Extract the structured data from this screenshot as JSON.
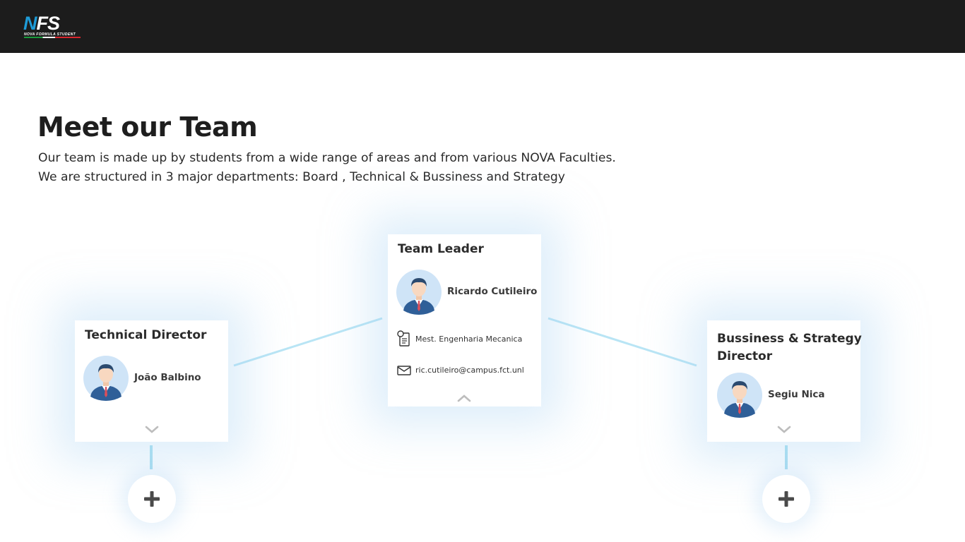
{
  "header": {
    "logo_text": "NFS",
    "logo_subtext": "NOVA FORMULA STUDENT",
    "background_color": "#1c1c1c"
  },
  "hero": {
    "title": "Meet our Team",
    "intro_line1": "Our team is made up by students from a wide range of areas and from various NOVA Faculties.",
    "intro_line2": "We are structured in 3 major departments: Board , Technical & Bussiness and Strategy"
  },
  "org_chart": {
    "leader": {
      "role": "Team Leader",
      "name": "Ricardo Cutileiro",
      "degree": "Mest. Engenharia Mecanica",
      "email": "ric.cutileiro@campus.fct.unl",
      "expanded": true
    },
    "technical": {
      "role": "Technical Director",
      "name": "João Balbino",
      "expanded": false
    },
    "business": {
      "role_line1": "Bussiness & Strategy",
      "role_line2": "Director",
      "name": "Segiu Nica",
      "expanded": false
    },
    "connector_color": "#a8dcf0"
  },
  "icons": {
    "degree": "document-icon",
    "email": "mail-icon",
    "expand": "chevron-down-icon",
    "collapse": "chevron-up-icon",
    "add": "plus-icon"
  }
}
